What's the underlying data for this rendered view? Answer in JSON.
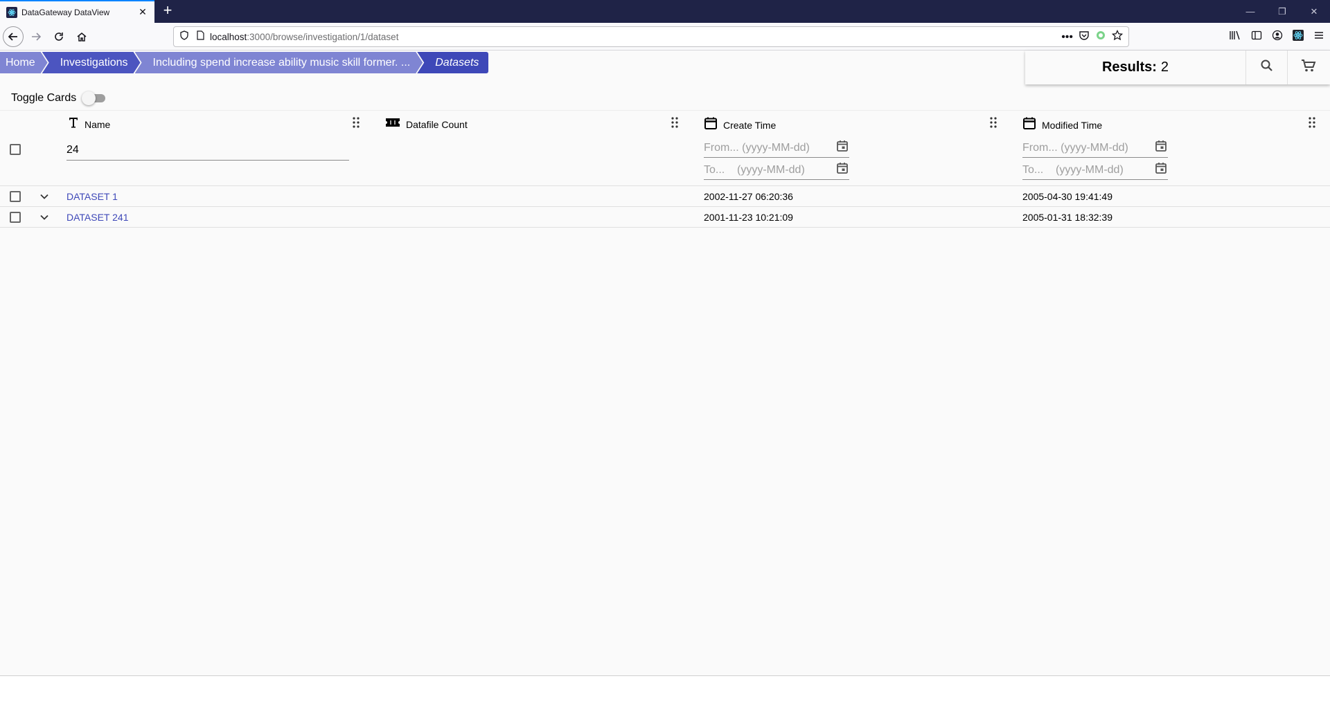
{
  "browser": {
    "tab_title": "DataGateway DataView",
    "url_host": "localhost",
    "url_path": ":3000/browse/investigation/1/dataset"
  },
  "breadcrumbs": [
    {
      "label": "Home"
    },
    {
      "label": "Investigations"
    },
    {
      "label": "Including spend increase ability music skill former. ..."
    },
    {
      "label": "Datasets"
    }
  ],
  "results": {
    "label": "Results:",
    "count": "2"
  },
  "toggle_cards": {
    "label": "Toggle Cards",
    "checked": false
  },
  "columns": {
    "name": "Name",
    "datafile_count": "Datafile Count",
    "create_time": "Create Time",
    "modified_time": "Modified Time"
  },
  "filters": {
    "name_value": "24",
    "from_placeholder": "From... (yyyy-MM-dd)",
    "to_placeholder": "To...    (yyyy-MM-dd)"
  },
  "rows": [
    {
      "name": "DATASET 1",
      "datafile_count": "",
      "create_time": "2002-11-27 06:20:36",
      "modified_time": "2005-04-30 19:41:49"
    },
    {
      "name": "DATASET 241",
      "datafile_count": "",
      "create_time": "2001-11-23 10:21:09",
      "modified_time": "2005-01-31 18:32:39"
    }
  ],
  "colors": {
    "chrome_dark": "#1f2347",
    "breadcrumb_active": "#3e48b8",
    "breadcrumb_light": "#7f85d3",
    "link": "#3e48b8"
  }
}
